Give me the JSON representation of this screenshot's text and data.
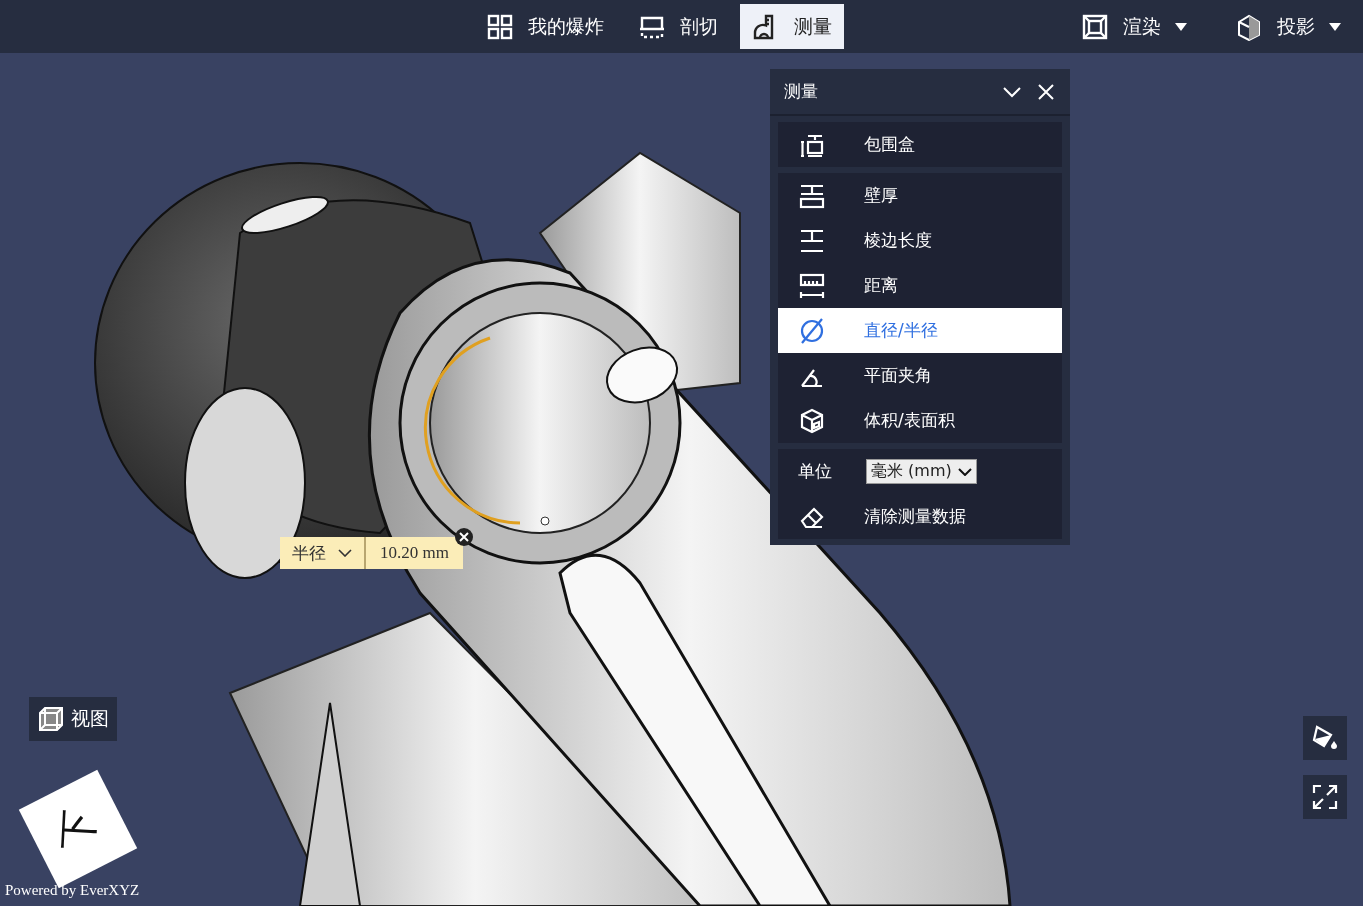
{
  "toolbar": {
    "items": [
      {
        "label": "我的爆炸",
        "kind": "grid",
        "selected": false
      },
      {
        "label": "剖切",
        "kind": "section",
        "selected": false
      },
      {
        "label": "测量",
        "kind": "measure",
        "selected": true
      }
    ],
    "menus": [
      {
        "label": "渲染",
        "kind": "render"
      },
      {
        "label": "投影",
        "kind": "projection"
      }
    ]
  },
  "measure_panel": {
    "title": "测量",
    "groups": [
      [
        {
          "label": "包围盒",
          "kind": "bbox",
          "selected": false
        }
      ],
      [
        {
          "label": "壁厚",
          "kind": "thickness",
          "selected": false
        },
        {
          "label": "棱边长度",
          "kind": "edge",
          "selected": false
        },
        {
          "label": "距离",
          "kind": "distance",
          "selected": false
        },
        {
          "label": "直径/半径",
          "kind": "diameter",
          "selected": true
        },
        {
          "label": "平面夹角",
          "kind": "angle",
          "selected": false
        },
        {
          "label": "体积/表面积",
          "kind": "volume",
          "selected": false
        }
      ]
    ],
    "unit_label": "单位",
    "unit_value": "毫米 (mm)",
    "clear_label": "清除测量数据"
  },
  "measurement_tag": {
    "mode": "半径",
    "value": "10.20 mm"
  },
  "view_button": "视图",
  "view_cube_face": "下",
  "footer": "Powered by EverXYZ"
}
